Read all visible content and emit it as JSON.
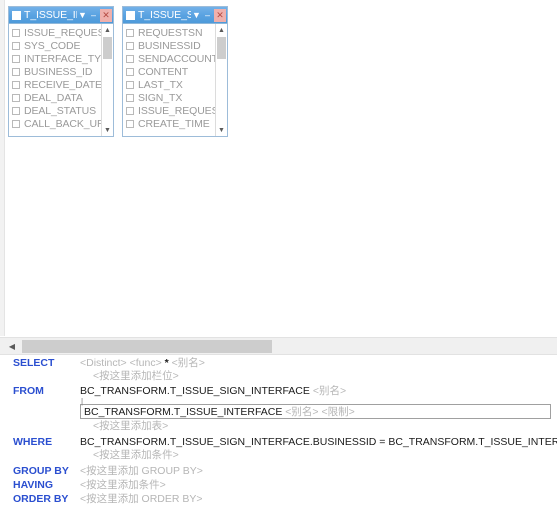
{
  "canvas": {
    "tables": [
      {
        "title": "T_ISSUE_INTI",
        "title_full": "T_ISSUE_INTERFACE",
        "dropdown_icon": "chevron-down-icon",
        "minimize_icon": "minimize-icon",
        "close_icon": "close-icon",
        "fields": [
          "ISSUE_REQUEST_SN",
          "SYS_CODE",
          "INTERFACE_TYPE",
          "BUSINESS_ID",
          "RECEIVE_DATE",
          "DEAL_DATA",
          "DEAL_STATUS",
          "CALL_BACK_URL"
        ],
        "scroll_up_icon": "chevron-up-icon",
        "scroll_down_icon": "chevron-down-icon"
      },
      {
        "title": "T_ISSUE_SIGI",
        "title_full": "T_ISSUE_SIGN_INTERFACE",
        "dropdown_icon": "chevron-down-icon",
        "minimize_icon": "minimize-icon",
        "close_icon": "close-icon",
        "fields": [
          "REQUESTSN",
          "BUSINESSID",
          "SENDACCOUNT",
          "CONTENT",
          "LAST_TX",
          "SIGN_TX",
          "ISSUE_REQUESTSN",
          "CREATE_TIME"
        ],
        "scroll_up_icon": "chevron-up-icon",
        "scroll_down_icon": "chevron-down-icon"
      }
    ],
    "hscrollbar": {
      "left_arrow_icon": "chevron-left-icon"
    }
  },
  "sql": {
    "select": {
      "keyword": "SELECT",
      "distinct_placeholder": "<Distinct>",
      "func_placeholder": "<func>",
      "star": "*",
      "alias_placeholder": "<别名>",
      "add_column_placeholder": "<按这里添加栏位>"
    },
    "from": {
      "keyword": "FROM",
      "table1": "BC_TRANSFORM.T_ISSUE_SIGN_INTERFACE",
      "table1_alias_placeholder": "<别名>",
      "table2": "BC_TRANSFORM.T_ISSUE_INTERFACE",
      "table2_alias_placeholder": "<别名>",
      "table2_restrict_placeholder": "<限制>",
      "add_table_placeholder": "<按这里添加表>"
    },
    "where": {
      "keyword": "WHERE",
      "condition": "BC_TRANSFORM.T_ISSUE_SIGN_INTERFACE.BUSINESSID = BC_TRANSFORM.T_ISSUE_INTERFACE.BUSINESS_ID",
      "add_condition_placeholder": "<按这里添加条件>"
    },
    "group_by": {
      "keyword": "GROUP BY",
      "placeholder": "<按这里添加 GROUP BY>"
    },
    "having": {
      "keyword": "HAVING",
      "placeholder": "<按这里添加条件>"
    },
    "order_by": {
      "keyword": "ORDER BY",
      "placeholder": "<按这里添加 ORDER BY>"
    }
  },
  "colors": {
    "keyword": "#2b4fd0",
    "titlebar": "#5aa3e2",
    "placeholder": "#b6b6b6",
    "field_text": "#9a9a9a"
  }
}
